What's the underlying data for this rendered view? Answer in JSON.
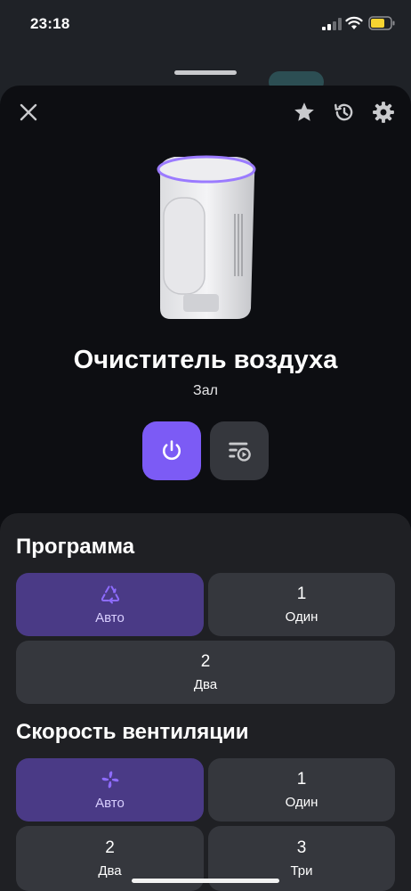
{
  "status_bar": {
    "time": "23:18"
  },
  "device": {
    "title": "Очиститель воздуха",
    "room": "Зал"
  },
  "program": {
    "title": "Программа",
    "options": [
      {
        "label": "Авто",
        "icon": "auto-cycle-icon",
        "selected": true
      },
      {
        "number": "1",
        "label": "Один",
        "selected": false
      },
      {
        "number": "2",
        "label": "Два",
        "selected": false
      }
    ]
  },
  "fan_speed": {
    "title": "Скорость вентиляции",
    "options": [
      {
        "label": "Авто",
        "icon": "fan-icon",
        "selected": true
      },
      {
        "number": "1",
        "label": "Один",
        "selected": false
      },
      {
        "number": "2",
        "label": "Два",
        "selected": false
      },
      {
        "number": "3",
        "label": "Три",
        "selected": false
      }
    ]
  },
  "colors": {
    "accent": "#7c5bf5",
    "selected_tile": "#4a3a86",
    "tile": "#35373d",
    "sheet_background": "#0d0e12",
    "panel_background": "#1f2024"
  }
}
